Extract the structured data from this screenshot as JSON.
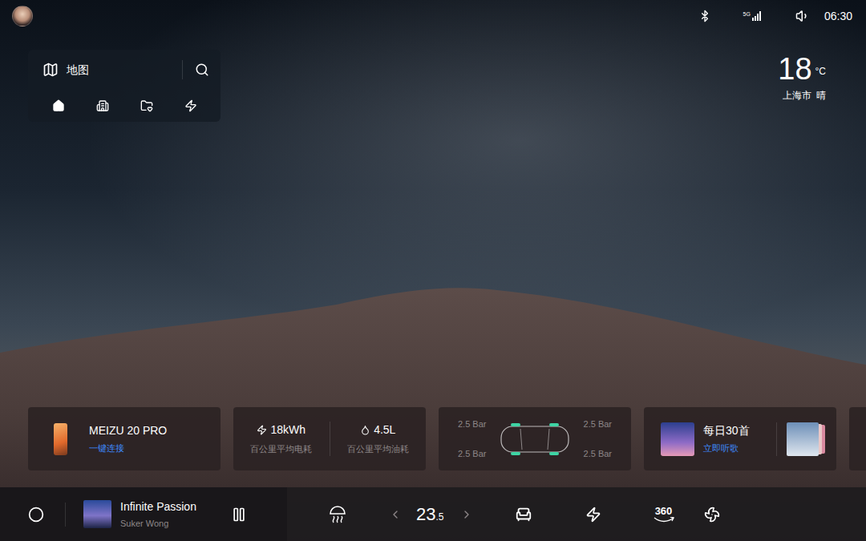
{
  "status_bar": {
    "network": "5G",
    "time": "06:30"
  },
  "map_widget": {
    "title": "地图"
  },
  "weather": {
    "temperature": "18",
    "unit": "°C",
    "city": "上海市",
    "condition": "晴"
  },
  "phone_card": {
    "name": "MEIZU 20 PRO",
    "action": "一键连接"
  },
  "consumption_card": [
    {
      "kind": "electric",
      "value": "18kWh",
      "label": "百公里平均电耗"
    },
    {
      "kind": "fuel",
      "value": "4.5L",
      "label": "百公里平均油耗"
    }
  ],
  "tire_card": [
    {
      "reading": "2.5 Bar"
    },
    {
      "reading": "2.5 Bar"
    },
    {
      "reading": "2.5 Bar"
    },
    {
      "reading": "2.5 Bar"
    }
  ],
  "music_card": {
    "title": "每日30首",
    "action": "立即听歌"
  },
  "dock": {
    "media": {
      "title": "Infinite Passion",
      "artist": "Suker Wong",
      "playing": true
    },
    "climate": {
      "temperature_whole": "23",
      "temperature_fraction": ".5"
    },
    "view_label": "360"
  }
}
